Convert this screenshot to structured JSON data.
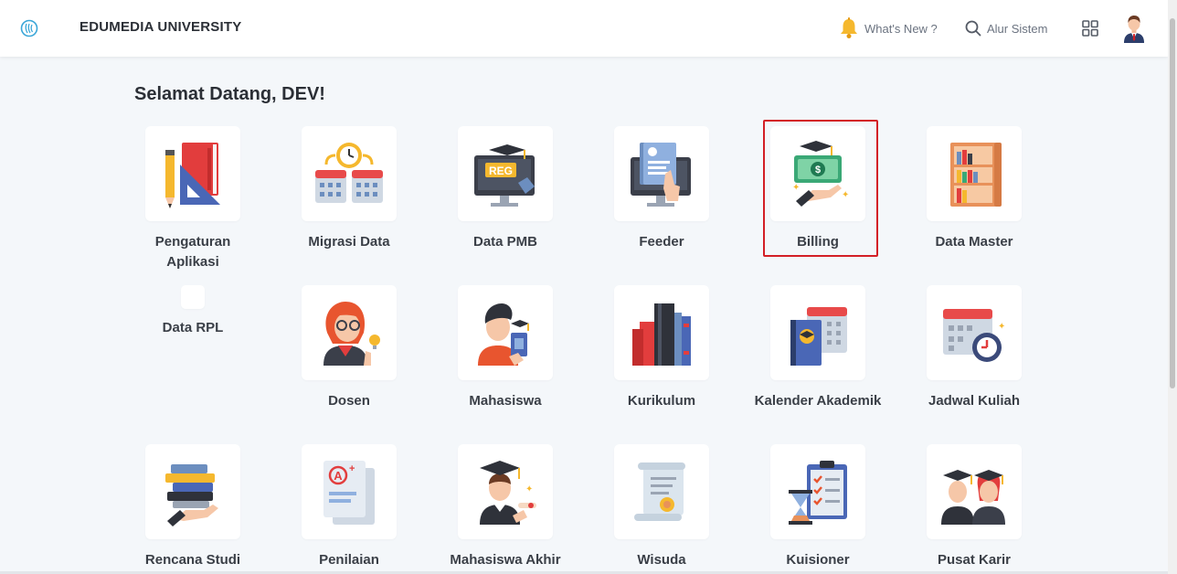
{
  "header": {
    "brand": "EDUMEDIA UNIVERSITY",
    "whats_new": "What's New ?",
    "alur_sistem": "Alur Sistem"
  },
  "welcome": "Selamat Datang, DEV!",
  "menu": [
    {
      "label": "Pengaturan Aplikasi",
      "icon": "ruler-book-icon"
    },
    {
      "label": "Migrasi Data",
      "icon": "calendar-clock-icon"
    },
    {
      "label": "Data PMB",
      "icon": "reg-monitor-icon"
    },
    {
      "label": "Feeder",
      "icon": "document-monitor-icon"
    },
    {
      "label": "Billing",
      "icon": "money-hand-icon"
    },
    {
      "label": "Data Master",
      "icon": "bookshelf-icon"
    },
    {
      "label": "Data RPL",
      "icon": ""
    },
    {
      "label": "Dosen",
      "icon": "lecturer-icon"
    },
    {
      "label": "Mahasiswa",
      "icon": "student-icon"
    },
    {
      "label": "Kurikulum",
      "icon": "books-icon"
    },
    {
      "label": "Kalender Akademik",
      "icon": "calendar-book-icon"
    },
    {
      "label": "Jadwal Kuliah",
      "icon": "calendar-timer-icon"
    },
    {
      "label": "Rencana Studi",
      "icon": "book-stack-hand-icon"
    },
    {
      "label": "Penilaian",
      "icon": "grade-paper-icon"
    },
    {
      "label": "Mahasiswa Akhir",
      "icon": "graduate-icon"
    },
    {
      "label": "Wisuda",
      "icon": "certificate-icon"
    },
    {
      "label": "Kuisioner",
      "icon": "checklist-hourglass-icon"
    },
    {
      "label": "Pusat Karir",
      "icon": "graduates-icon"
    }
  ],
  "colors": {
    "accent_red": "#d31f26",
    "background": "#f4f7fa",
    "bell_yellow": "#f5b82e"
  }
}
